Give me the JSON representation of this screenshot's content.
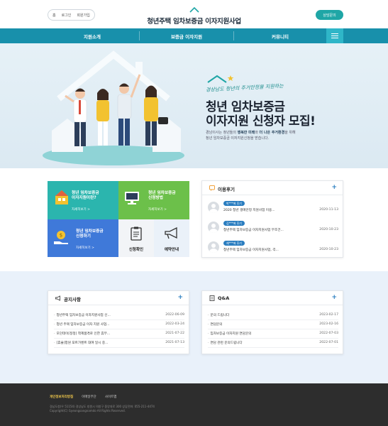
{
  "header": {
    "util_links": [
      "홈",
      "로그인",
      "회원가입"
    ],
    "logo_text": "청년주택 임차보증금 이자지원사업",
    "consult_button": "상담문의"
  },
  "nav": {
    "items": [
      "지원소개",
      "보증금 이자지원",
      "커뮤니티"
    ]
  },
  "hero": {
    "subtitle": "경상남도 청년의 주거안정을 지원하는",
    "title_line1": "청년 임차보증금",
    "title_line2": "이자지원 신청자 모집!",
    "desc_line1_pre": "경남이사는 청년들의 ",
    "desc_line1_bold1": "행복한 미래",
    "desc_line1_mid": "와 ",
    "desc_line1_bold2": "더 나은 주거환경",
    "desc_line1_post": "을 위해",
    "desc_line2": "청년 임차보증금 이자지원신청을 받습니다."
  },
  "tiles": {
    "tile1": {
      "title_line1": "청년 임차보증금",
      "title_line2": "이자지원이란?",
      "more": "자세히보기 >",
      "color": "#2bb5ae"
    },
    "tile2": {
      "title_line1": "청년 임차보증금",
      "title_line2": "신청방법",
      "more": "자세히보기 >",
      "color": "#6cc04a"
    },
    "tile3": {
      "title_line1": "청년 임차보증금",
      "title_line2": "신청하기",
      "more": "자세히보기 >",
      "color": "#3f79d9"
    },
    "tile4": {
      "label": "신청확인"
    },
    "tile5": {
      "label": "예약안내"
    }
  },
  "reviews": {
    "title": "이용후기",
    "plus": "+",
    "items": [
      {
        "badge": "박***에 후기",
        "text": "2020 청년 생애안정 지원사업 이용...",
        "date": "2020-11-13"
      },
      {
        "badge": "김***에 후기",
        "text": "청년주택 임차보증금 이자지원사업 무조건...",
        "date": "2020-10-23"
      },
      {
        "badge": "채***에 후기",
        "text": "청년주택 임차보증금 이자지원사업, 걱...",
        "date": "2020-10-23"
      }
    ]
  },
  "notices": {
    "title": "공지사항",
    "plus": "+",
    "items": [
      {
        "text": "청년주택 임차보증금 이자지원사업 신...",
        "date": "2022-06-09"
      },
      {
        "text": "청년 주택 임차보증금 이자 지원 사업...",
        "date": "2022-03-24"
      },
      {
        "text": "모던데이[정정] 착제품격로 인한 휴무...",
        "date": "2021-07-22"
      },
      {
        "text": "[휴술]창원 포트가벤트 대여 일시 중...",
        "date": "2021-07-13"
      }
    ]
  },
  "qna": {
    "title": "Q&A",
    "plus": "+",
    "items": [
      {
        "text": "문의 드립니다",
        "date": "2023-02-17"
      },
      {
        "text": "면담문의",
        "date": "2023-02-16"
      },
      {
        "text": "임차보증금 이자지원 면담문의",
        "date": "2022-07-03"
      },
      {
        "text": "면담 관련 문의드립니다",
        "date": "2022-07-01"
      }
    ]
  },
  "footer": {
    "links": [
      "개인정보처리방침",
      "이메일무단",
      "사이트맵"
    ],
    "info_line1": "경남도청(우 51154) 경상남도 창원시 의창구 중앙대로 300 상담전화: 055-211-4474",
    "info_line2": "Copyright(C) Gyeongsangnamdo All Rights Reserved."
  },
  "colors": {
    "nav": "#1890ab",
    "accent": "#1fa6a6",
    "link_blue": "#2a7dc0"
  }
}
